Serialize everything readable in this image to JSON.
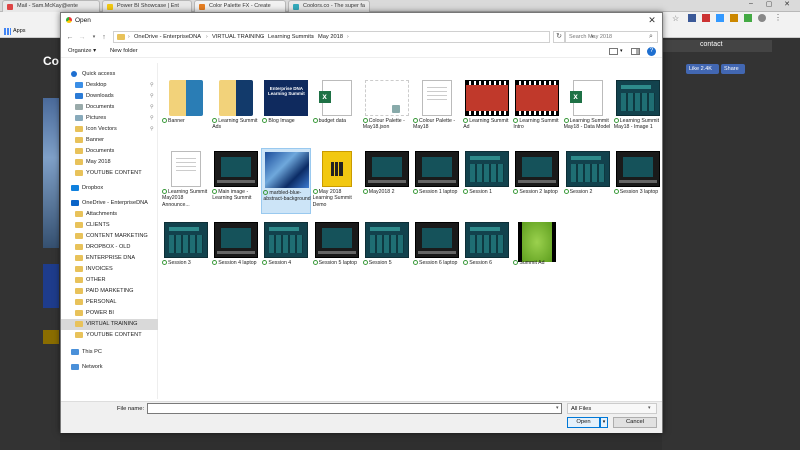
{
  "browser": {
    "tabs": [
      "Mail - Sam.McKay@ente",
      "Power BI Showcase | Ent",
      "Color Palette FX - Create",
      "Coolors.co - The super fa"
    ],
    "bookmarks_label": "Apps"
  },
  "page": {
    "title_fragment": "Co",
    "nav_contact": "contact",
    "like": "Like 2.4K",
    "share": "Share"
  },
  "dialog": {
    "title": "Open",
    "close": "✕",
    "back": "←",
    "forward": "→",
    "up": "↑",
    "breadcrumb": [
      "OneDrive - EnterpriseDNA",
      "VIRTUAL TRAINING",
      "Learning Summits",
      "May 2018"
    ],
    "search_placeholder": "Search May 2018",
    "organize": "Organize ▾",
    "new_folder": "New folder",
    "nav_items": [
      {
        "label": "Quick access",
        "icon": "star-icon",
        "pinned": false
      },
      {
        "label": "Desktop",
        "icon": "desktop-icon",
        "pinned": true
      },
      {
        "label": "Downloads",
        "icon": "download-icon",
        "pinned": true
      },
      {
        "label": "Documents",
        "icon": "documents-icon",
        "pinned": true
      },
      {
        "label": "Pictures",
        "icon": "pictures-icon",
        "pinned": true
      },
      {
        "label": "Icon Vectors",
        "icon": "folder-icon",
        "pinned": true
      },
      {
        "label": "Banner",
        "icon": "folder-icon",
        "pinned": false
      },
      {
        "label": "Documents",
        "icon": "folder-icon",
        "pinned": false
      },
      {
        "label": "May 2018",
        "icon": "folder-icon",
        "pinned": false
      },
      {
        "label": "YOUTUBE CONTENT",
        "icon": "folder-icon",
        "pinned": false
      },
      {
        "label": "Dropbox",
        "icon": "dropbox-icon",
        "pinned": false
      },
      {
        "label": "OneDrive - EnterpriseDNA",
        "icon": "onedrive-icon",
        "pinned": false
      },
      {
        "label": "Attachments",
        "icon": "folder-icon",
        "pinned": false
      },
      {
        "label": "CLIENTS",
        "icon": "folder-icon",
        "pinned": false
      },
      {
        "label": "CONTENT MARKETING",
        "icon": "folder-icon",
        "pinned": false
      },
      {
        "label": "DROPBOX - OLD",
        "icon": "folder-icon",
        "pinned": false
      },
      {
        "label": "ENTERPRISE DNA",
        "icon": "folder-icon",
        "pinned": false
      },
      {
        "label": "INVOICES",
        "icon": "folder-icon",
        "pinned": false
      },
      {
        "label": "OTHER",
        "icon": "folder-icon",
        "pinned": false
      },
      {
        "label": "PAID MARKETING",
        "icon": "folder-icon",
        "pinned": false
      },
      {
        "label": "PERSONAL",
        "icon": "folder-icon",
        "pinned": false
      },
      {
        "label": "POWER BI",
        "icon": "folder-icon",
        "pinned": false
      },
      {
        "label": "VIRTUAL TRAINING",
        "icon": "folder-icon",
        "pinned": false,
        "selected": true
      },
      {
        "label": "YOUTUBE CONTENT",
        "icon": "folder-icon",
        "pinned": false
      },
      {
        "label": "This PC",
        "icon": "pc-icon",
        "pinned": false
      },
      {
        "label": "Network",
        "icon": "network-icon",
        "pinned": false
      }
    ],
    "files": [
      {
        "name": "Banner",
        "kind": "banner"
      },
      {
        "name": "Learning Summit Ads",
        "kind": "ads"
      },
      {
        "name": "Blog Image",
        "kind": "blog",
        "thumb_text": "Enterprise DNA Learning Summit"
      },
      {
        "name": "budget data",
        "kind": "excel"
      },
      {
        "name": "Colour Palette - May18.json",
        "kind": "json"
      },
      {
        "name": "Colour Palette - May18",
        "kind": "doc"
      },
      {
        "name": "Learning Summit Ad",
        "kind": "video"
      },
      {
        "name": "Learning Summit Intro",
        "kind": "video"
      },
      {
        "name": "Learning Summit May18 - Data Model",
        "kind": "excel"
      },
      {
        "name": "Learning Summit May18 - Image 1",
        "kind": "screen"
      },
      {
        "name": "Learning Summit May2018 Announce...",
        "kind": "doc"
      },
      {
        "name": "Main image - Learning Summit",
        "kind": "laptop"
      },
      {
        "name": "marbled-blue-abstract-background",
        "kind": "marble",
        "selected": true
      },
      {
        "name": "May 2018 Learning Summit Demo",
        "kind": "pbix"
      },
      {
        "name": "May2018 2",
        "kind": "laptop"
      },
      {
        "name": "Session 1 laptop",
        "kind": "laptop"
      },
      {
        "name": "Session 1",
        "kind": "screen"
      },
      {
        "name": "Session 2 laptop",
        "kind": "laptop"
      },
      {
        "name": "Session 2",
        "kind": "screen"
      },
      {
        "name": "Session 3 laptop",
        "kind": "laptop"
      },
      {
        "name": "Session 3",
        "kind": "screen"
      },
      {
        "name": "Session 4 laptop",
        "kind": "laptop"
      },
      {
        "name": "Session 4",
        "kind": "screen"
      },
      {
        "name": "Session 5 laptop",
        "kind": "laptop"
      },
      {
        "name": "Session 5",
        "kind": "screen"
      },
      {
        "name": "Session 6 laptop",
        "kind": "laptop"
      },
      {
        "name": "Session 6",
        "kind": "screen"
      },
      {
        "name": "Summit Ad",
        "kind": "green"
      }
    ],
    "file_name_label": "File name:",
    "file_name_value": "",
    "file_type": "All Files",
    "open": "Open",
    "cancel": "Cancel"
  }
}
